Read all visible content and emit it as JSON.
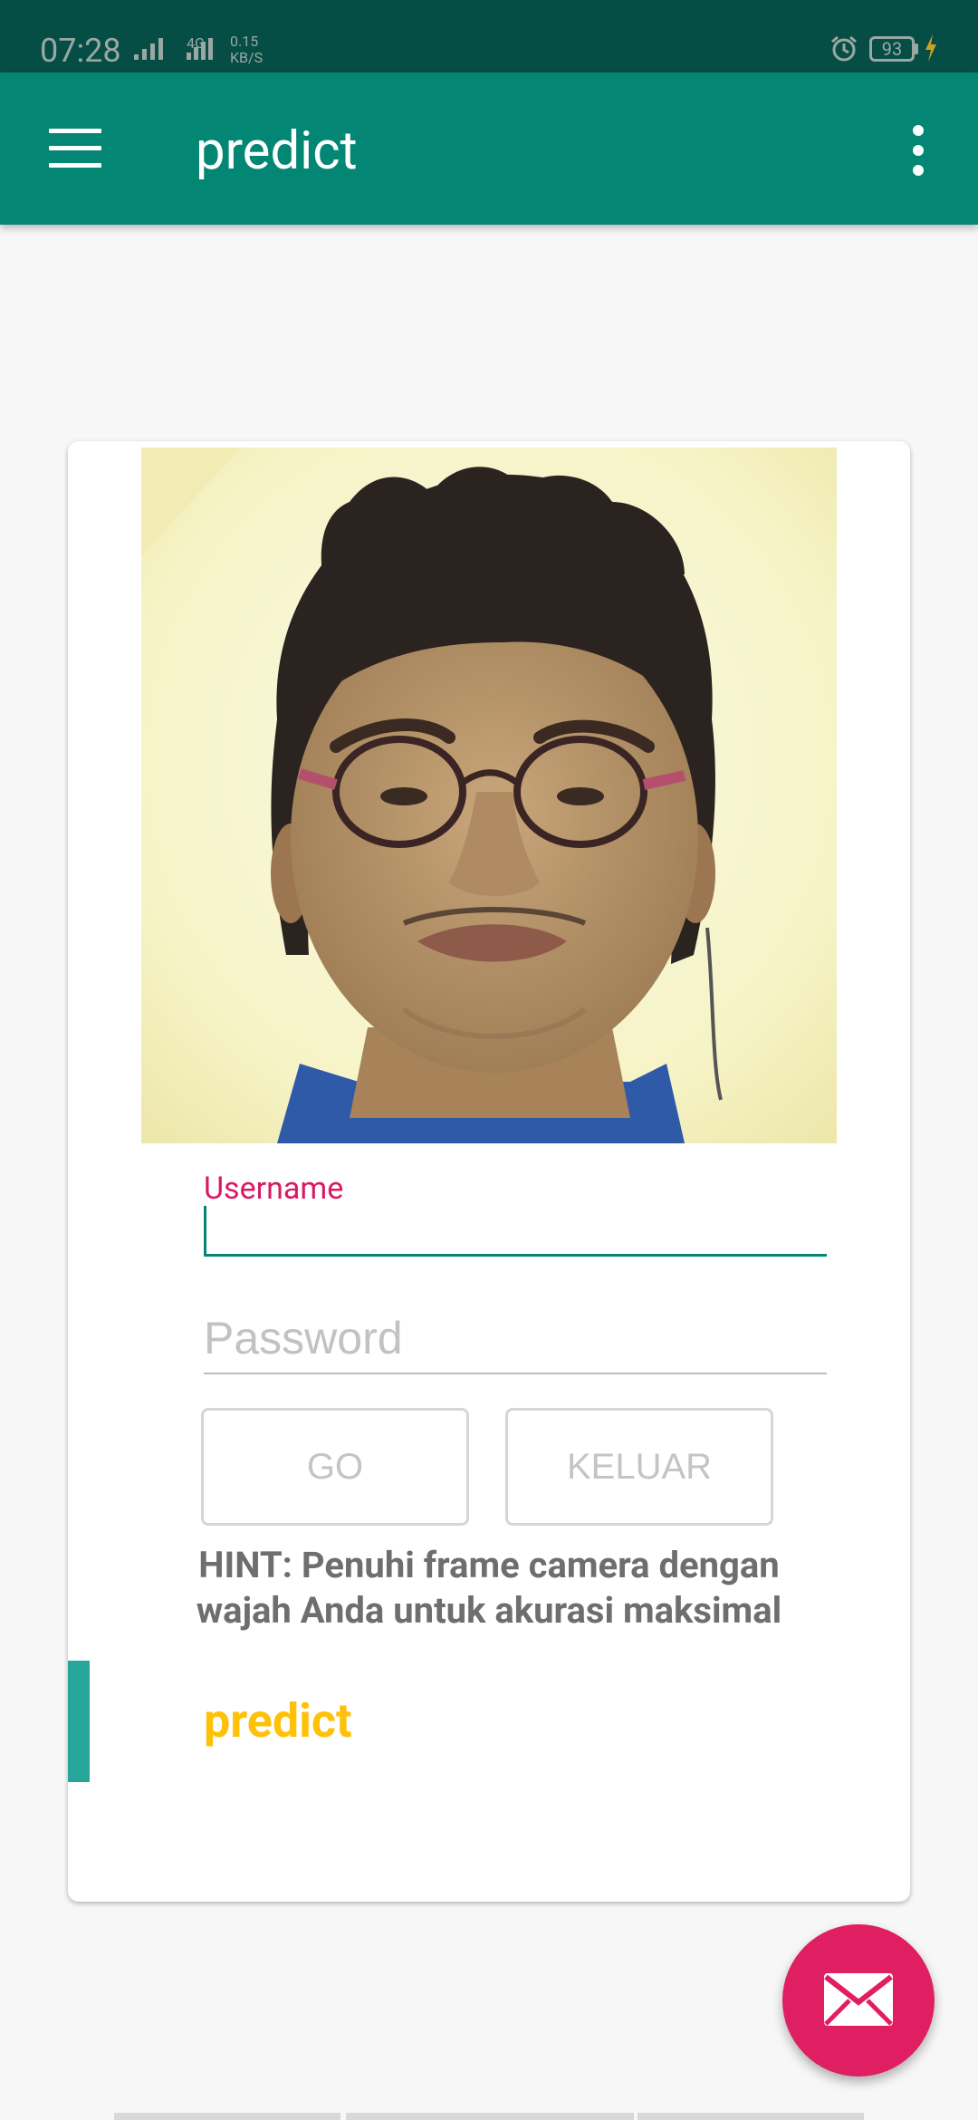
{
  "status_bar": {
    "time": "07:28",
    "network_label": "4G",
    "speed_value": "0.15",
    "speed_unit": "KB/S",
    "battery_level": "93"
  },
  "app_bar": {
    "title": "predict",
    "menu_icon": "hamburger-menu-icon",
    "overflow_icon": "more-vert-icon"
  },
  "form": {
    "username_label": "Username",
    "username_value": "",
    "password_placeholder": "Password",
    "go_button": "GO",
    "keluar_button": "KELUAR"
  },
  "hint": {
    "line1": "HINT: Penuhi frame camera dengan",
    "line2": "wajah Anda untuk akurasi maksimal"
  },
  "result": {
    "label": "predict"
  },
  "fab": {
    "icon": "mail-icon"
  },
  "colors": {
    "status_bar": "#064e45",
    "app_bar": "#048674",
    "label_accent": "#d81b60",
    "result_text": "#ffc107",
    "fab": "#e01e62",
    "accent_bar": "#26a69a"
  }
}
